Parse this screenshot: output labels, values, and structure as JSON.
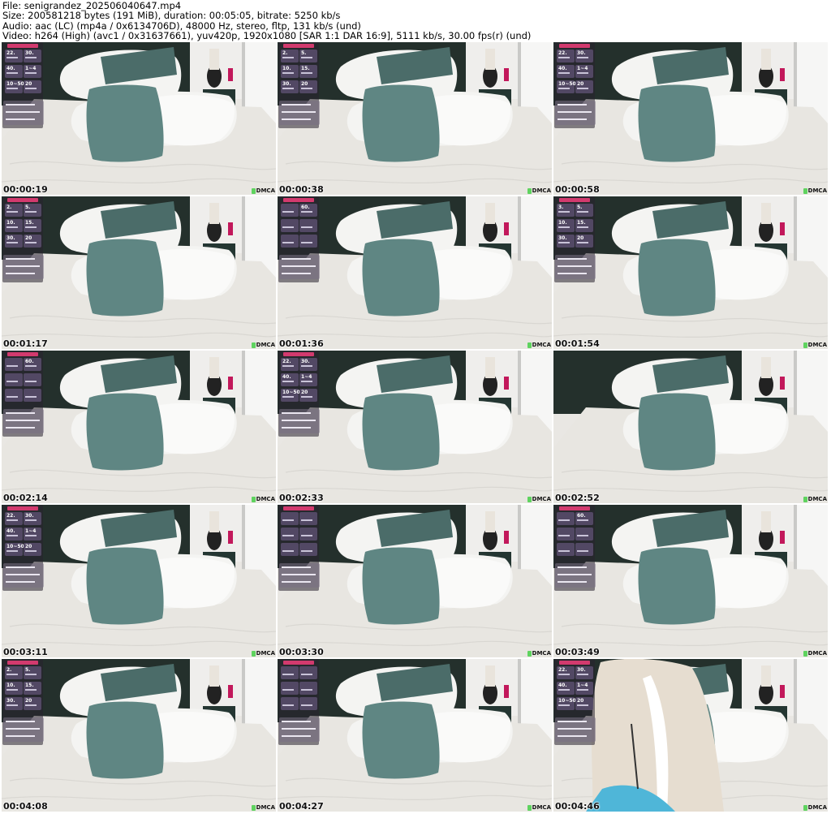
{
  "header": {
    "line_file": "File: senigrandez_202506040647.mp4",
    "line_size": "Size: 200581218 bytes (191 MiB), duration: 00:05:05, bitrate: 5250 kb/s",
    "line_audio": "Audio: aac (LC) (mp4a / 0x6134706D), 48000 Hz, stereo, fltp, 131 kb/s (und)",
    "line_video": "Video: h264 (High) (avc1 / 0x31637661), yuv420p, 1920x1080 [SAR 1:1 DAR 16:9], 5111 kb/s, 30.00 fps(r) (und)"
  },
  "watermark_text": "DMCA",
  "colors": {
    "wall": "#24302c",
    "bed": "#e8e6e1",
    "pillow_white": "#f4f4f2",
    "cushion_teal": "#5f8683",
    "cushion_dark": "#4b6c69",
    "accent_pink": "#d23a6e",
    "watermark_green": "#5fd35f"
  },
  "frames": [
    {
      "time": "00:00:19",
      "overlay": true,
      "cells": [
        "22.",
        "30.",
        "40.",
        "1~4",
        "10~50",
        "20"
      ]
    },
    {
      "time": "00:00:38",
      "overlay": true,
      "cells": [
        "2.",
        "5.",
        "10.",
        "15.",
        "30.",
        "20"
      ]
    },
    {
      "time": "00:00:58",
      "overlay": true,
      "cells": [
        "22.",
        "30.",
        "40.",
        "1~4",
        "10~50",
        "20"
      ]
    },
    {
      "time": "00:01:17",
      "overlay": true,
      "cells": [
        "2.",
        "5.",
        "10.",
        "15.",
        "30.",
        "20"
      ]
    },
    {
      "time": "00:01:36",
      "overlay": true,
      "cells": [
        "",
        "60.",
        "",
        "",
        "",
        ""
      ]
    },
    {
      "time": "00:01:54",
      "overlay": true,
      "cells": [
        "3.",
        "5.",
        "10.",
        "15.",
        "30.",
        "20"
      ]
    },
    {
      "time": "00:02:14",
      "overlay": true,
      "cells": [
        "",
        "60.",
        "",
        "",
        "",
        ""
      ]
    },
    {
      "time": "00:02:33",
      "overlay": true,
      "cells": [
        "22.",
        "30.",
        "40.",
        "1~4",
        "10~50",
        "20"
      ]
    },
    {
      "time": "00:02:52",
      "overlay": false,
      "cells": []
    },
    {
      "time": "00:03:11",
      "overlay": true,
      "cells": [
        "22.",
        "30.",
        "40.",
        "1~4",
        "10~50",
        "20"
      ]
    },
    {
      "time": "00:03:30",
      "overlay": true,
      "cells": [
        "",
        "",
        "",
        "",
        "",
        ""
      ]
    },
    {
      "time": "00:03:49",
      "overlay": true,
      "cells": [
        "",
        "60.",
        "",
        "",
        "",
        ""
      ]
    },
    {
      "time": "00:04:08",
      "overlay": true,
      "cells": [
        "2.",
        "5.",
        "10.",
        "15.",
        "30.",
        "20"
      ]
    },
    {
      "time": "00:04:27",
      "overlay": true,
      "cells": [
        "",
        "",
        "",
        "",
        "",
        ""
      ]
    },
    {
      "time": "00:04:46",
      "overlay": true,
      "cells": [
        "22.",
        "30.",
        "40.",
        "1~4",
        "10~50",
        "20"
      ],
      "person": true
    }
  ]
}
